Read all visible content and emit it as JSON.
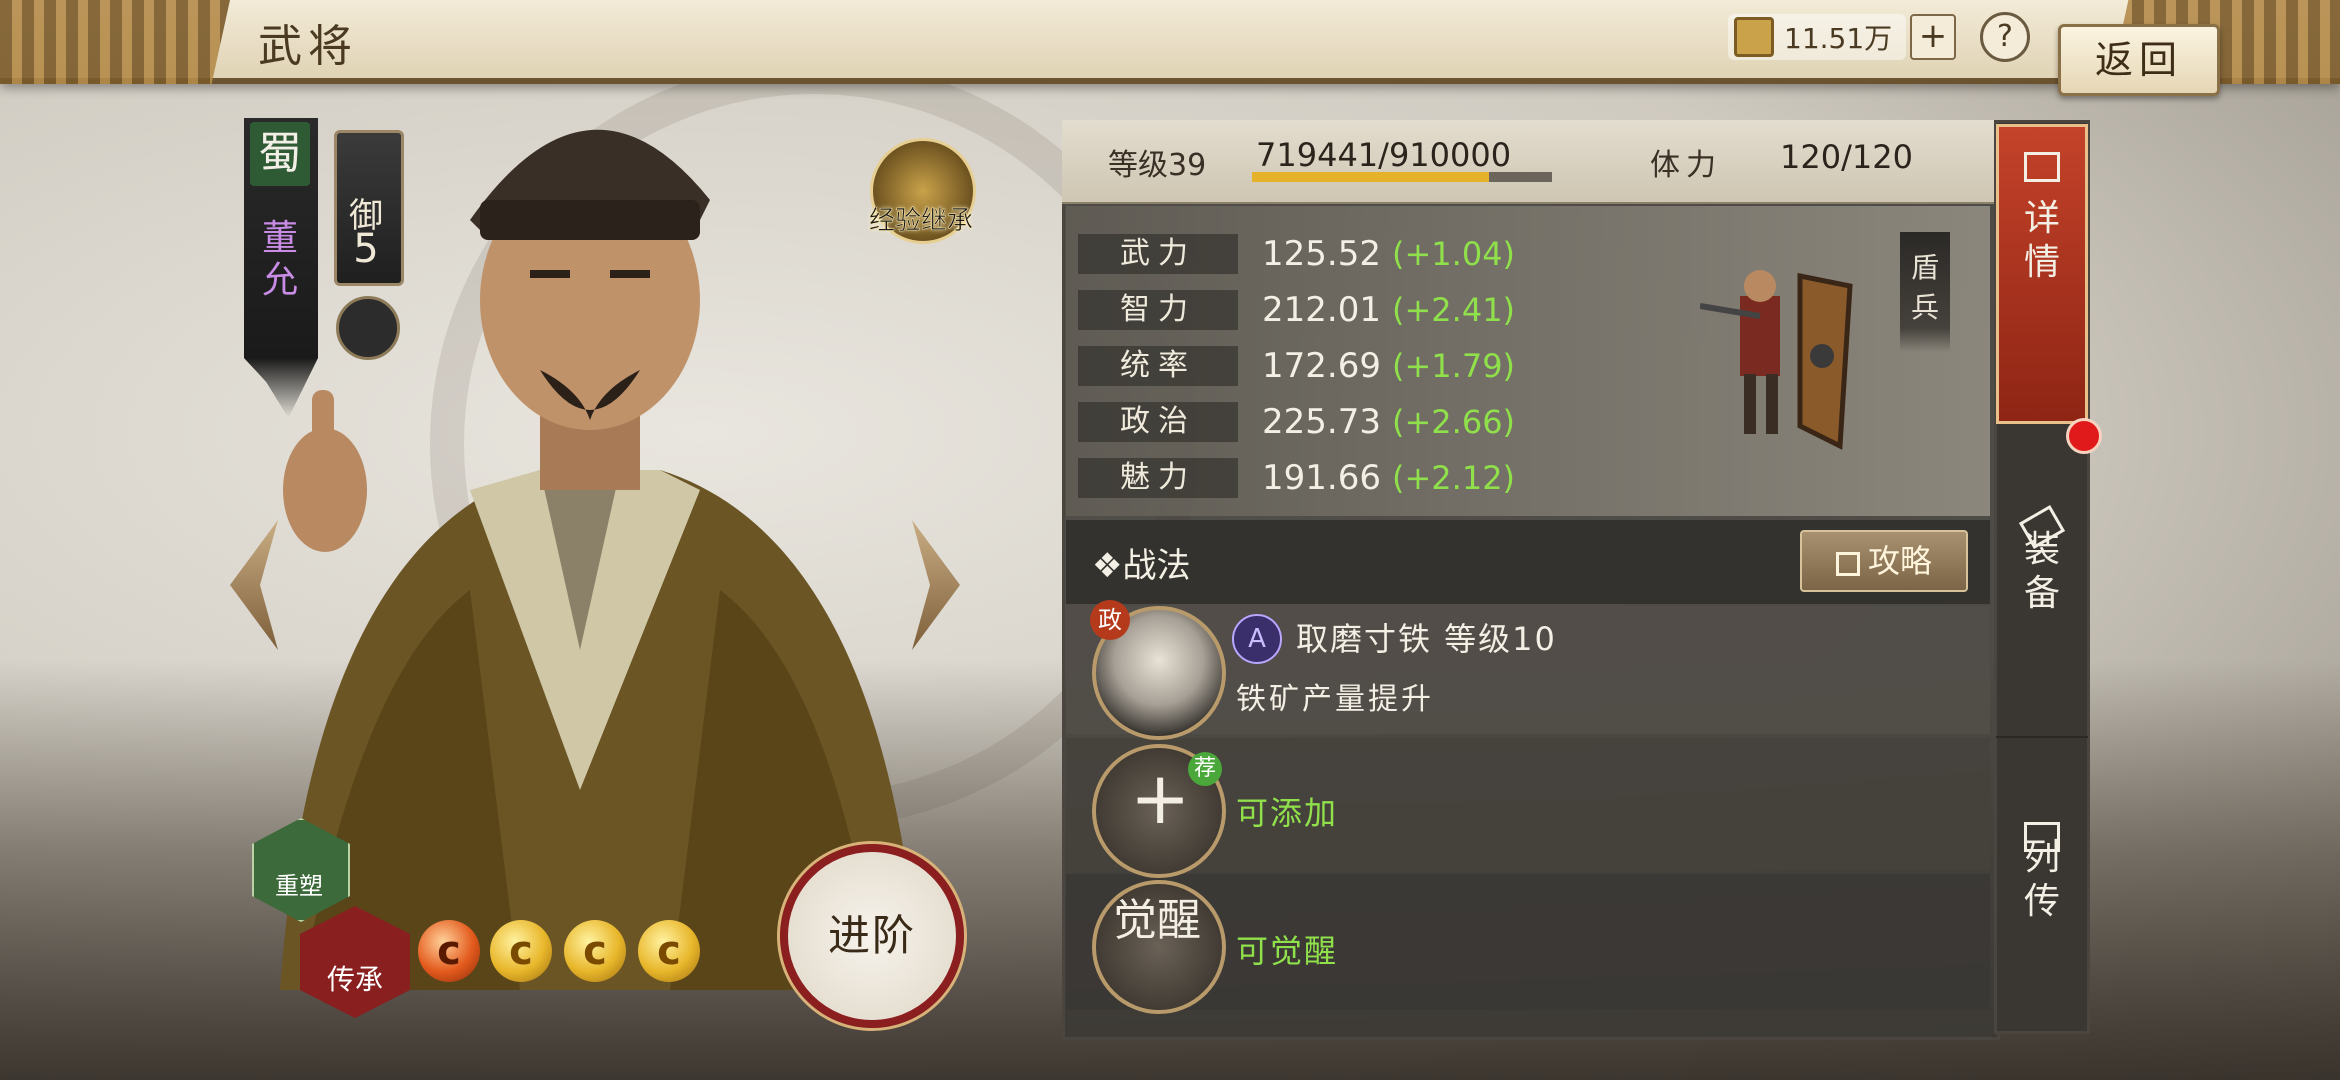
{
  "header": {
    "title": "武将",
    "currency_value": "11.51万",
    "plus_label": "+",
    "help_label": "?",
    "back_label": "返回"
  },
  "hero": {
    "faction": "蜀",
    "name": "董允",
    "cost_label": "御",
    "cost_value": "5",
    "inherit_exp_label": "经验继承",
    "rebuild_label": "重塑",
    "legacy_label": "传承",
    "advance_label": "进阶",
    "stars": {
      "total": 5,
      "red": 1
    }
  },
  "panel": {
    "level_label": "等级39",
    "exp_text": "719441/910000",
    "exp_progress": 0.79,
    "stamina_label": "体力",
    "stamina_value": "120/120",
    "troop_type": "盾兵",
    "stats": [
      {
        "name": "武力",
        "value": "125.52",
        "bonus": "(+1.04)"
      },
      {
        "name": "智力",
        "value": "212.01",
        "bonus": "(+2.41)"
      },
      {
        "name": "统率",
        "value": "172.69",
        "bonus": "(+1.79)"
      },
      {
        "name": "政治",
        "value": "225.73",
        "bonus": "(+2.66)"
      },
      {
        "name": "魅力",
        "value": "191.66",
        "bonus": "(+2.12)"
      }
    ],
    "skills_title": "❖战法",
    "guide_label": "攻略",
    "skill1": {
      "type_badge": "政",
      "grade": "A",
      "name": "取磨寸铁  等级10",
      "desc": "铁矿产量提升"
    },
    "skill2": {
      "rec_badge": "荐",
      "label": "可添加",
      "plus": "+"
    },
    "skill3": {
      "glyph": "觉醒",
      "label": "可觉醒"
    }
  },
  "tabs": {
    "details": "详情",
    "equip": "装备",
    "bio": "列传"
  },
  "colors": {
    "accent_red": "#c4422a",
    "bonus_green": "#8fe04a",
    "exp_gold": "#e6b22c",
    "name_purple": "#c88ce6"
  }
}
